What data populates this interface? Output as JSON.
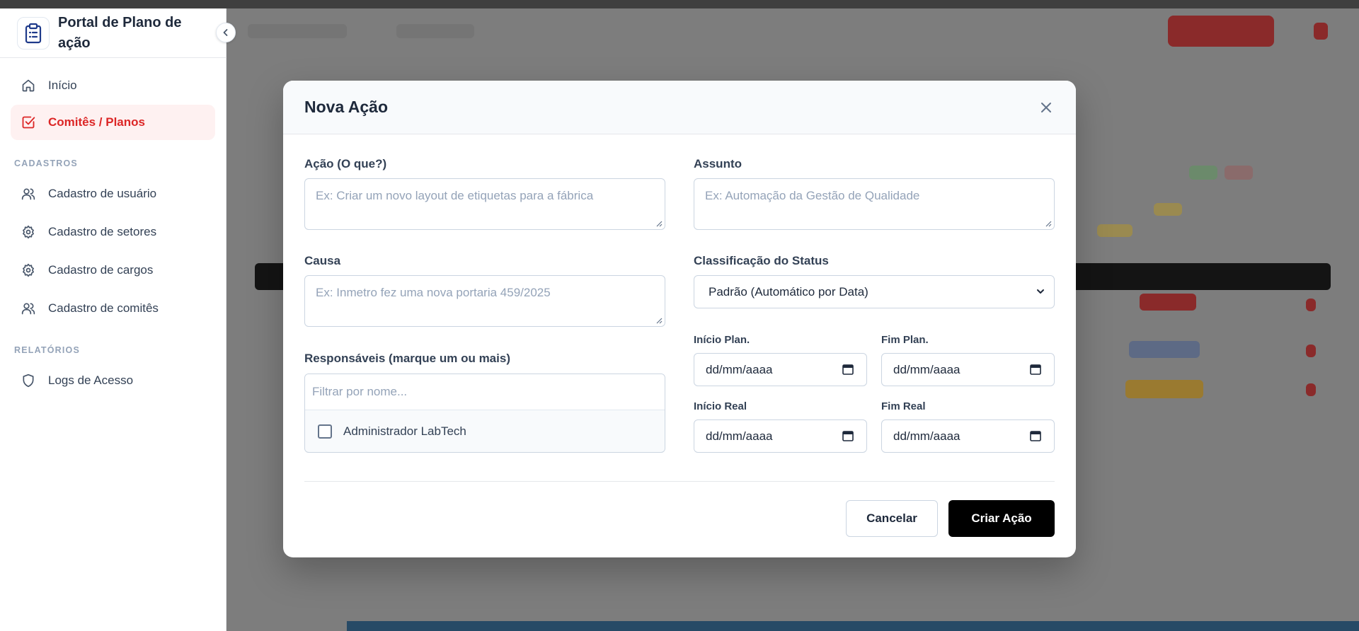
{
  "app": {
    "title": "Portal de Plano de ação"
  },
  "sidebar": {
    "items": [
      {
        "label": "Início",
        "icon": "home-icon",
        "active": false
      },
      {
        "label": "Comitês / Planos",
        "icon": "checkbox-square-icon",
        "active": true
      }
    ],
    "sections": [
      {
        "label": "CADASTROS",
        "items": [
          {
            "label": "Cadastro de usuário",
            "icon": "users-icon"
          },
          {
            "label": "Cadastro de setores",
            "icon": "gear-icon"
          },
          {
            "label": "Cadastro de cargos",
            "icon": "gear-icon"
          },
          {
            "label": "Cadastro de comitês",
            "icon": "users-icon"
          }
        ]
      },
      {
        "label": "RELATÓRIOS",
        "items": [
          {
            "label": "Logs de Acesso",
            "icon": "shield-icon"
          }
        ]
      }
    ]
  },
  "modal": {
    "title": "Nova Ação",
    "fields": {
      "acao": {
        "label": "Ação (O que?)",
        "placeholder": "Ex: Criar um novo layout de etiquetas para a fábrica"
      },
      "assunto": {
        "label": "Assunto",
        "placeholder": "Ex: Automação da Gestão de Qualidade"
      },
      "causa": {
        "label": "Causa",
        "placeholder": "Ex: Inmetro fez uma nova portaria 459/2025"
      },
      "status": {
        "label": "Classificação do Status",
        "value": "Padrão (Automático por Data)"
      },
      "responsaveis": {
        "label": "Responsáveis (marque um ou mais)",
        "filter_placeholder": "Filtrar por nome...",
        "options": [
          {
            "name": "Administrador LabTech",
            "checked": false
          }
        ]
      },
      "inicio_plan": {
        "label": "Início Plan.",
        "value": "dd/mm/aaaa"
      },
      "fim_plan": {
        "label": "Fim Plan.",
        "value": "dd/mm/aaaa"
      },
      "inicio_real": {
        "label": "Início Real",
        "value": "dd/mm/aaaa"
      },
      "fim_real": {
        "label": "Fim Real",
        "value": "dd/mm/aaaa"
      }
    },
    "buttons": {
      "cancel": "Cancelar",
      "create": "Criar Ação"
    }
  },
  "colors": {
    "accent": "#dc2626",
    "active_bg": "#fef1f1",
    "overlay": "#7c7c7c",
    "primary_button": "#000000"
  }
}
